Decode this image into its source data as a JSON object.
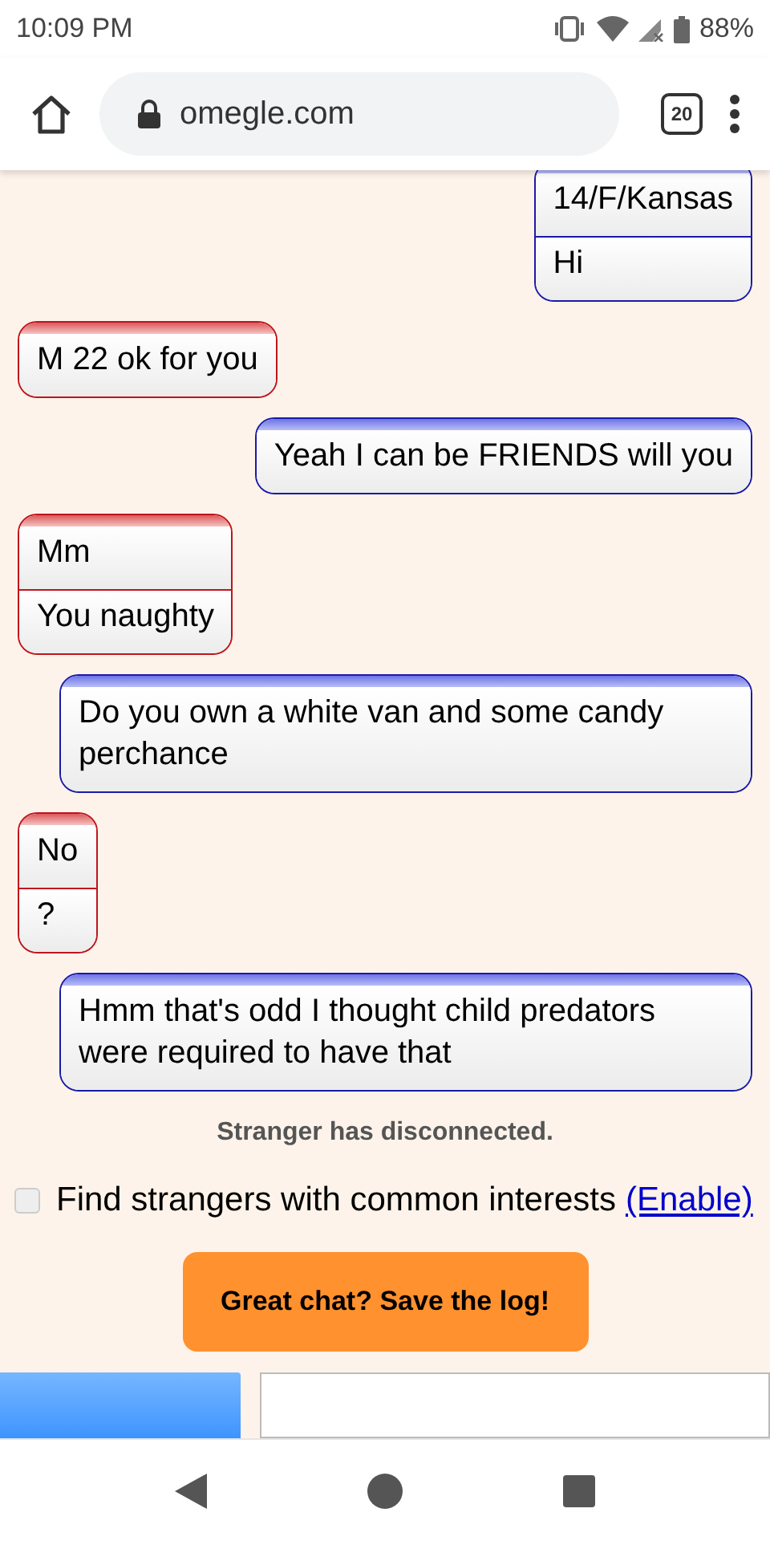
{
  "status_bar": {
    "time": "10:09 PM",
    "battery": "88%"
  },
  "browser": {
    "url": "omegle.com",
    "tab_count": "20"
  },
  "messages": [
    {
      "kind": "you",
      "lines": [
        "14/F/Kansas",
        "Hi"
      ]
    },
    {
      "kind": "stranger",
      "lines": [
        "M 22 ok for you"
      ]
    },
    {
      "kind": "you",
      "lines": [
        "Yeah I can be FRIENDS will you"
      ]
    },
    {
      "kind": "stranger",
      "lines": [
        "Mm",
        "You naughty"
      ]
    },
    {
      "kind": "you",
      "lines": [
        "Do you own a white van and some candy perchance"
      ]
    },
    {
      "kind": "stranger",
      "lines": [
        "No",
        "?"
      ]
    },
    {
      "kind": "you",
      "lines": [
        "Hmm that's odd I thought child predators were required to have that"
      ]
    }
  ],
  "status_message": "Stranger has disconnected.",
  "interests": {
    "label": "Find strangers with common interests",
    "link": "(Enable)",
    "checked": false
  },
  "save_button": "Great chat? Save the log!"
}
